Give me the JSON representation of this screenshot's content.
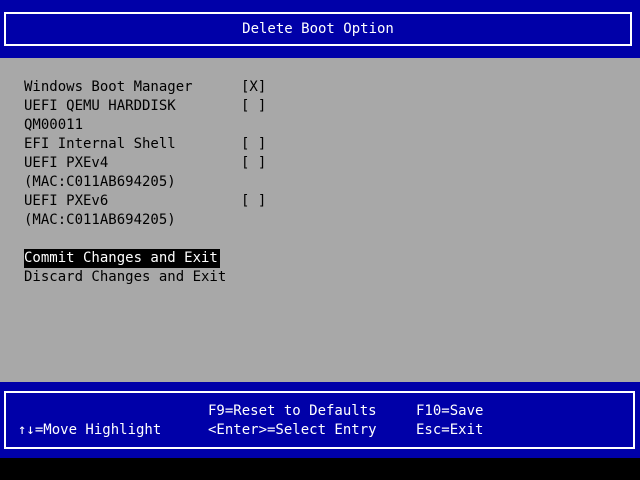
{
  "header": {
    "title": "Delete Boot Option"
  },
  "options": [
    {
      "label": "Windows Boot Manager",
      "check": "[X]"
    },
    {
      "label": "UEFI QEMU HARDDISK",
      "check": "[ ]"
    },
    {
      "label": "QM00011",
      "check": ""
    },
    {
      "label": "EFI Internal Shell",
      "check": "[ ]"
    },
    {
      "label": "UEFI PXEv4",
      "check": "[ ]"
    },
    {
      "label": "(MAC:C011AB694205)",
      "check": ""
    },
    {
      "label": "UEFI PXEv6",
      "check": "[ ]"
    },
    {
      "label": "(MAC:C011AB694205)",
      "check": ""
    }
  ],
  "actions": {
    "commit": "Commit Changes and Exit",
    "discard": "Discard Changes and Exit"
  },
  "footer": {
    "move_highlight": "↑↓=Move Highlight",
    "reset_defaults": "F9=Reset to Defaults",
    "select_entry": "<Enter>=Select Entry",
    "save": "F10=Save",
    "exit": "Esc=Exit"
  },
  "colors": {
    "header_bg": "#0000a8",
    "body_bg": "#a8a8a8",
    "highlight_bg": "#000000",
    "text_light": "#ffffff"
  }
}
